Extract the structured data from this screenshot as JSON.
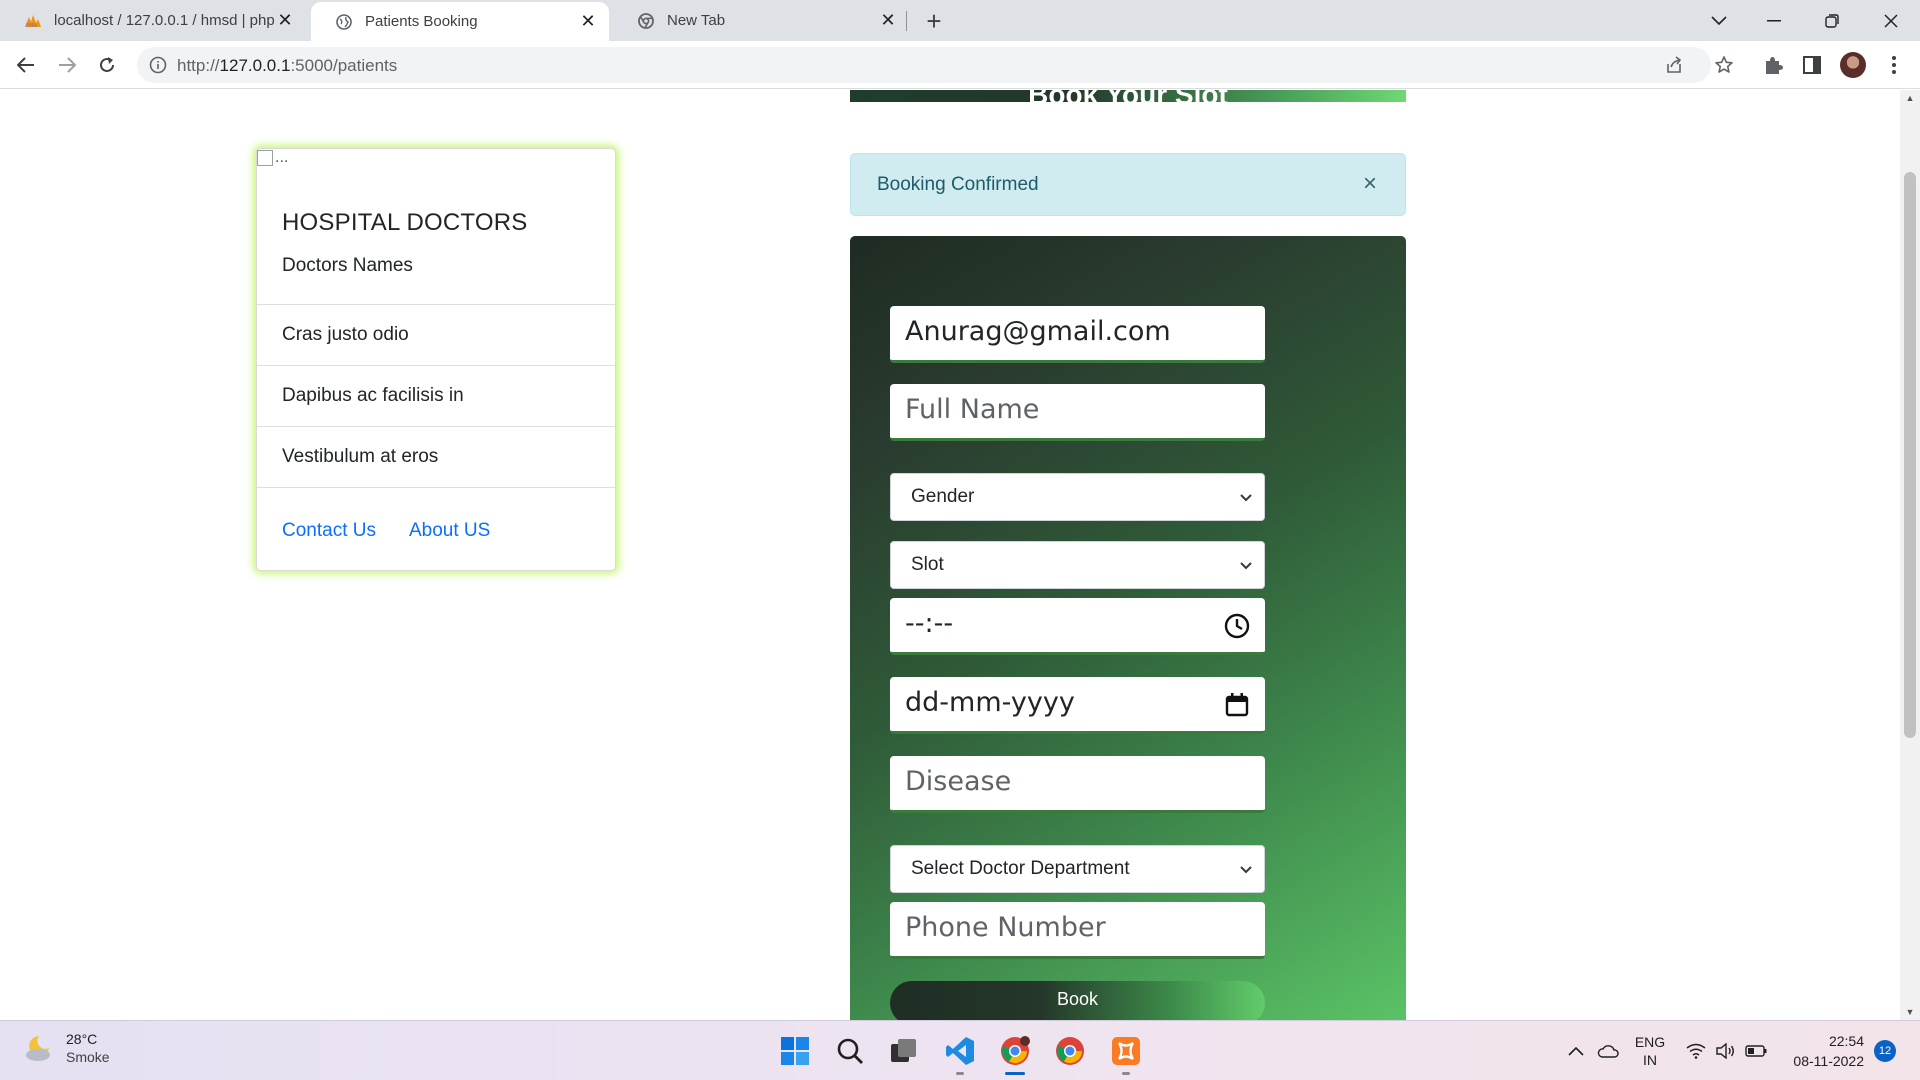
{
  "browser": {
    "tabs": [
      {
        "title": "localhost / 127.0.0.1 / hmsd | php",
        "favicon": "phpmyadmin-icon"
      },
      {
        "title": "Patients Booking",
        "favicon": "globe-icon"
      },
      {
        "title": "New Tab",
        "favicon": "chrome-icon"
      }
    ],
    "active_tab": 1,
    "url_prefix": "http://",
    "url_host": "127.0.0.1",
    "url_path": ":5000/patients"
  },
  "page": {
    "header_title": "Book Your Slot",
    "doctors_card": {
      "image_alt": "...",
      "title": "HOSPITAL DOCTORS",
      "subtitle": "Doctors Names",
      "items": [
        "Cras justo odio",
        "Dapibus ac facilisis in",
        "Vestibulum at eros"
      ],
      "links": [
        "Contact Us",
        "About US"
      ]
    },
    "alert": {
      "message": "Booking Confirmed",
      "close_symbol": "×"
    },
    "form": {
      "email_value": "Anurag@gmail.com",
      "full_name_placeholder": "Full Name",
      "gender_selected": "Gender",
      "slot_selected": "Slot",
      "time_placeholder": "--:--",
      "date_placeholder": "dd-mm-yyyy",
      "disease_placeholder": "Disease",
      "department_selected": "Select Doctor Department",
      "phone_placeholder": "Phone Number",
      "submit_label": "Book"
    }
  },
  "taskbar": {
    "weather_temp": "28°C",
    "weather_condition": "Smoke",
    "language_line1": "ENG",
    "language_line2": "IN",
    "time": "22:54",
    "date": "08-11-2022",
    "notification_count": "12"
  },
  "colors": {
    "accent_link": "#0d6efd",
    "alert_bg": "#d1ecf1",
    "card_glow": "#c8f77a",
    "panel_dark": "#1e2b22",
    "panel_light": "#5cc567"
  }
}
